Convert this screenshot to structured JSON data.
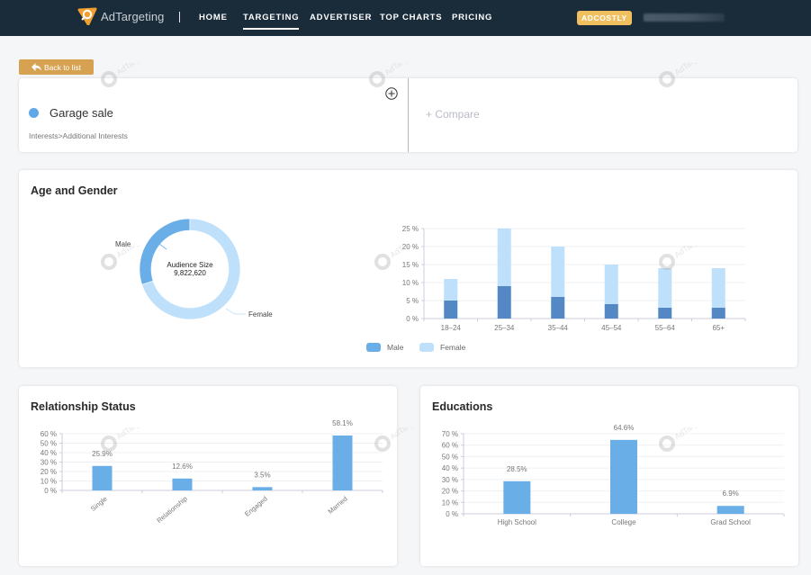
{
  "brand": {
    "name": "AdTargeting",
    "accent": "#f0a030"
  },
  "nav": {
    "items": [
      {
        "label": "HOME",
        "active": false
      },
      {
        "label": "TARGETING",
        "active": true
      },
      {
        "label": "ADVERTISER",
        "active": false
      },
      {
        "label": "TOP CHARTS",
        "active": false
      },
      {
        "label": "PRICING",
        "active": false
      }
    ],
    "badge": "ADCOSTLY"
  },
  "back_button": {
    "label": "Back to list",
    "icon": "reply-arrow-icon"
  },
  "segment": {
    "name": "Garage sale",
    "path": "Interests>Additional Interests",
    "dot_color": "#62a8e8",
    "add_icon": "plus-circle-icon",
    "compare_label": "+ Compare"
  },
  "watermark": "AdTargeting",
  "age_gender": {
    "title": "Age and Gender",
    "donut": {
      "center_label": "Audience Size",
      "center_value": "9,822,620",
      "slices": [
        {
          "label": "Male",
          "value": 30,
          "color": "#6aaee8"
        },
        {
          "label": "Female",
          "value": 70,
          "color": "#bfe0fa"
        }
      ]
    },
    "legend": [
      {
        "label": "Male",
        "color": "#6aaee8"
      },
      {
        "label": "Female",
        "color": "#bfe0fa"
      }
    ]
  },
  "relationship": {
    "title": "Relationship Status"
  },
  "education": {
    "title": "Educations"
  },
  "chart_data": [
    {
      "type": "pie",
      "title": "Audience Size",
      "subtitle": "9,822,620",
      "categories": [
        "Male",
        "Female"
      ],
      "values": [
        30,
        70
      ]
    },
    {
      "type": "bar",
      "stacked": true,
      "title": "Age and Gender",
      "categories": [
        "18–24",
        "25–34",
        "35–44",
        "45–54",
        "55–64",
        "65+"
      ],
      "series": [
        {
          "name": "Male",
          "color": "#5388c4",
          "values": [
            5,
            9,
            6,
            4,
            3,
            3
          ]
        },
        {
          "name": "Female",
          "color": "#bfe0fa",
          "values": [
            6,
            16,
            14,
            11,
            11,
            11
          ]
        }
      ],
      "yticks": [
        "0 %",
        "5 %",
        "10 %",
        "15 %",
        "20 %",
        "25 %"
      ],
      "ylim": [
        0,
        25
      ],
      "ylabel": "",
      "xlabel": "",
      "legend": "bottom",
      "grid": true
    },
    {
      "type": "bar",
      "title": "Relationship Status",
      "categories": [
        "Single",
        "Relationship",
        "Engaged",
        "Married"
      ],
      "values": [
        25.9,
        12.6,
        3.5,
        58.1
      ],
      "labels": [
        "25.9%",
        "12.6%",
        "3.5%",
        "58.1%"
      ],
      "yticks": [
        "0 %",
        "10 %",
        "20 %",
        "30 %",
        "40 %",
        "50 %",
        "60 %"
      ],
      "ylim": [
        0,
        60
      ],
      "color": "#6aaee8",
      "grid": true
    },
    {
      "type": "bar",
      "title": "Educations",
      "categories": [
        "High School",
        "College",
        "Grad School"
      ],
      "values": [
        28.5,
        64.6,
        6.9
      ],
      "labels": [
        "28.5%",
        "64.6%",
        "6.9%"
      ],
      "yticks": [
        "0 %",
        "10 %",
        "20 %",
        "30 %",
        "40 %",
        "50 %",
        "60 %",
        "70 %"
      ],
      "ylim": [
        0,
        70
      ],
      "color": "#6aaee8",
      "grid": true
    }
  ]
}
